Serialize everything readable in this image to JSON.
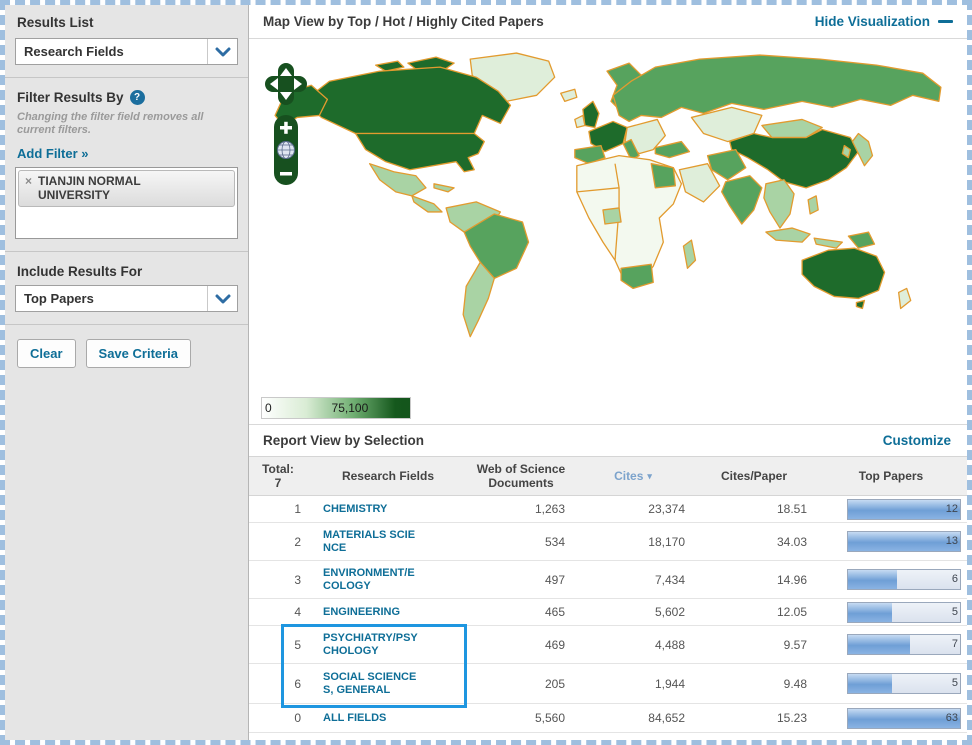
{
  "sidebar": {
    "results_list": {
      "title": "Results List",
      "dropdown_value": "Research Fields"
    },
    "filter": {
      "title": "Filter Results By",
      "help_icon": "?",
      "note": "Changing the filter field removes all current filters.",
      "add_filter_label": "Add Filter »",
      "tag": {
        "remove_icon": "×",
        "label": "TIANJIN NORMAL UNIVERSITY"
      }
    },
    "include_results": {
      "title": "Include Results For",
      "dropdown_value": "Top Papers"
    },
    "buttons": {
      "clear": "Clear",
      "save": "Save Criteria"
    }
  },
  "map_panel": {
    "title": "Map View by Top / Hot / Highly Cited Papers",
    "hide_link": "Hide Visualization",
    "legend": {
      "min": "0",
      "max": "75,100"
    },
    "palette": {
      "country_none": "#f3f9ef",
      "country_pale": "#dfeeda",
      "country_light": "#a9d3a4",
      "country_mid": "#57a35e",
      "country_dark": "#1e6b2b",
      "country_border": "#e29b2f",
      "control_green": "#17501f"
    },
    "zoom_in_icon": "+",
    "zoom_out_icon": "−"
  },
  "report": {
    "title": "Report View by Selection",
    "customize_label": "Customize",
    "table": {
      "total_label": "Total:",
      "total_value": "7",
      "col_field": "Research Fields",
      "col_docs": "Web of Science Documents",
      "col_cites": "Cites",
      "sort_arrow": "▾",
      "col_cpp": "Cites/Paper",
      "col_top": "Top Papers",
      "rows": [
        {
          "rank": "1",
          "field": "CHEMISTRY",
          "documents": "1,263",
          "cites": "23,374",
          "cites_per_paper": "18.51",
          "top_papers": "12",
          "bar_pct": 100
        },
        {
          "rank": "2",
          "field": "MATERIALS SCIENCE",
          "documents": "534",
          "cites": "18,170",
          "cites_per_paper": "34.03",
          "top_papers": "13",
          "bar_pct": 100
        },
        {
          "rank": "3",
          "field": "ENVIRONMENT/ECOLOGY",
          "documents": "497",
          "cites": "7,434",
          "cites_per_paper": "14.96",
          "top_papers": "6",
          "bar_pct": 44
        },
        {
          "rank": "4",
          "field": "ENGINEERING",
          "documents": "465",
          "cites": "5,602",
          "cites_per_paper": "12.05",
          "top_papers": "5",
          "bar_pct": 39
        },
        {
          "rank": "5",
          "field": "PSYCHIATRY/PSYCHOLOGY",
          "documents": "469",
          "cites": "4,488",
          "cites_per_paper": "9.57",
          "top_papers": "7",
          "bar_pct": 55
        },
        {
          "rank": "6",
          "field": "SOCIAL SCIENCES, GENERAL",
          "documents": "205",
          "cites": "1,944",
          "cites_per_paper": "9.48",
          "top_papers": "5",
          "bar_pct": 39
        },
        {
          "rank": "0",
          "field": "ALL FIELDS",
          "documents": "5,560",
          "cites": "84,652",
          "cites_per_paper": "15.23",
          "top_papers": "63",
          "bar_pct": 100
        }
      ]
    }
  }
}
